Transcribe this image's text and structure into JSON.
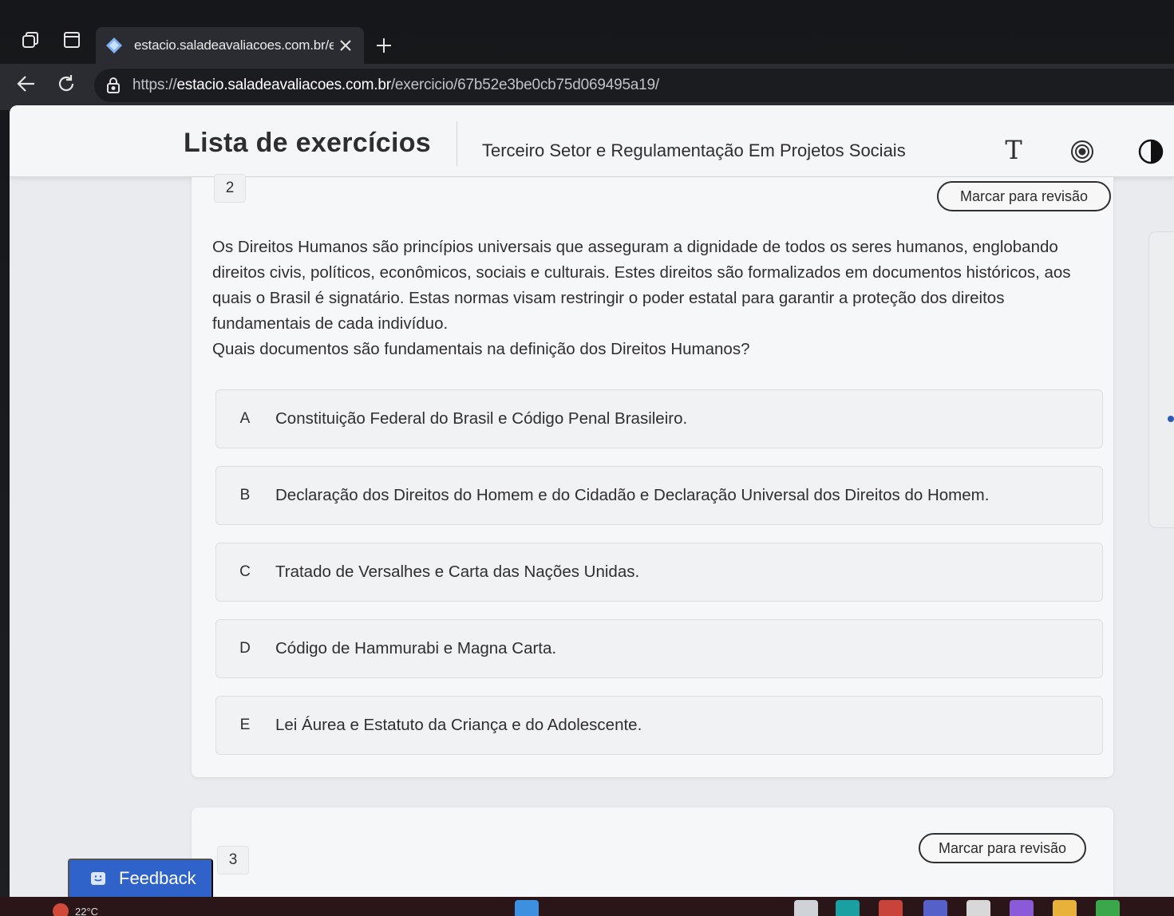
{
  "browser": {
    "tab_title": "estacio.saladeavaliacoes.com.br/e",
    "url_prefix": "https://",
    "url_host": "estacio.saladeavaliacoes.com.br",
    "url_path": "/exercicio/67b52e3be0cb75d069495a19/"
  },
  "header": {
    "title": "Lista de exercícios",
    "course": "Terceiro Setor e Regulamentação Em Projetos Sociais",
    "font_size_glyph": "T"
  },
  "question2": {
    "number": "2",
    "review_label": "Marcar para revisão",
    "statement": "Os Direitos Humanos são princípios universais que asseguram a dignidade de todos os seres humanos, englobando direitos civis, políticos, econômicos, sociais e culturais. Estes direitos são formalizados em documentos históricos, aos quais o Brasil é signatário. Estas normas visam restringir o poder estatal para garantir a proteção dos direitos fundamentais de cada indivíduo.",
    "prompt": "Quais documentos são fundamentais na definição dos Direitos Humanos?",
    "options": [
      {
        "letter": "A",
        "text": "Constituição Federal do Brasil e Código Penal Brasileiro."
      },
      {
        "letter": "B",
        "text": "Declaração dos Direitos do Homem e do Cidadão e Declaração Universal dos Direitos do Homem."
      },
      {
        "letter": "C",
        "text": "Tratado de Versalhes e Carta das Nações Unidas."
      },
      {
        "letter": "D",
        "text": "Código de Hammurabi e Magna Carta."
      },
      {
        "letter": "E",
        "text": "Lei Áurea e Estatuto da Criança e do Adolescente."
      }
    ]
  },
  "question3": {
    "number": "3",
    "review_label": "Marcar para revisão"
  },
  "feedback": {
    "label": "Feedback"
  },
  "taskbar": {
    "weather": "22°C"
  },
  "colors": {
    "feedback_blue": "#2f63c9",
    "page_background": "#e9ebee",
    "card_background": "#f6f7f8",
    "browser_chrome": "#2a2c31"
  },
  "icons": {
    "workspaces": "workspaces-icon",
    "tab_actions": "tab-actions-icon",
    "favicon": "favicon-icon",
    "close": "close-icon",
    "new_tab": "plus-icon",
    "back": "arrow-left-icon",
    "reload": "reload-icon",
    "lock": "lock-icon",
    "font_size": "font-size-icon",
    "accessibility": "accessibility-icon",
    "contrast": "contrast-icon",
    "feedback": "feedback-icon"
  }
}
